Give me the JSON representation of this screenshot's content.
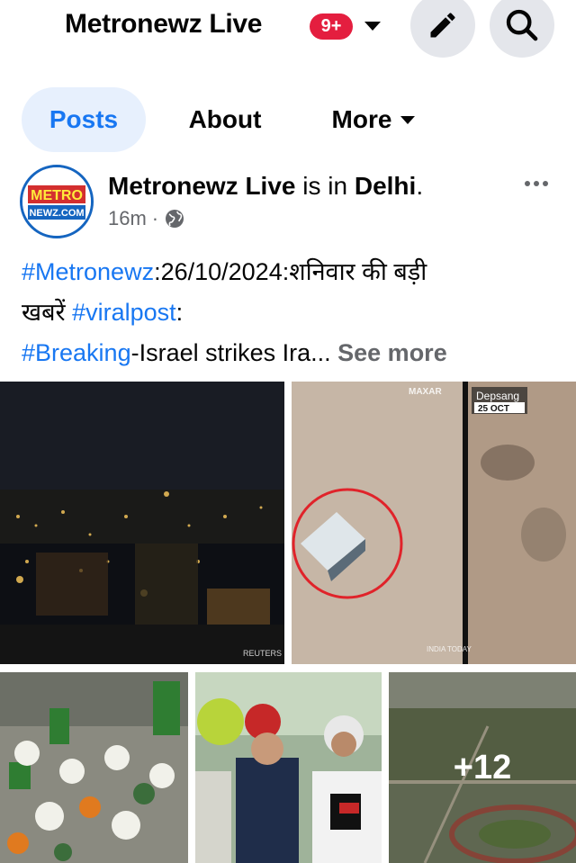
{
  "header": {
    "page_name": "Metronewz Live",
    "notification_count": "9+",
    "icons": [
      "caret-down-icon",
      "pencil-icon",
      "search-icon"
    ]
  },
  "tabs": [
    {
      "label": "Posts",
      "active": true
    },
    {
      "label": "About",
      "active": false
    },
    {
      "label": "More",
      "active": false
    }
  ],
  "post": {
    "author": "Metronewz Live",
    "location_prefix": "is in",
    "location": "Delhi",
    "time": "16m",
    "audience_icon": "globe-icon",
    "text": {
      "tag1": "#Metronewz",
      "line1_rest": ":26/10/2024:शनिवार की बड़ी",
      "line2_start": "खबरें ",
      "tag2": "#viralpost",
      "line2_end": ":",
      "tag3": "#Breaking",
      "line3_rest": "-Israel strikes Ira... ",
      "see_more": "See more"
    },
    "avatar_text": {
      "top": "METRO",
      "bottom": "NEWZ.COM"
    },
    "photos": {
      "photo1_credit": "REUTERS",
      "photo2_label_top": "MAXAR",
      "photo2_label_place": "Depsang",
      "photo2_label_date": "25 OCT",
      "photo2_watermark": "INDIA TODAY",
      "more_count": "+12"
    }
  },
  "colors": {
    "accent": "#1877f2",
    "badge": "#e41e3f",
    "secondary_text": "#65676b",
    "button_bg": "#e4e6eb",
    "active_tab_bg": "#e7f0fd"
  }
}
